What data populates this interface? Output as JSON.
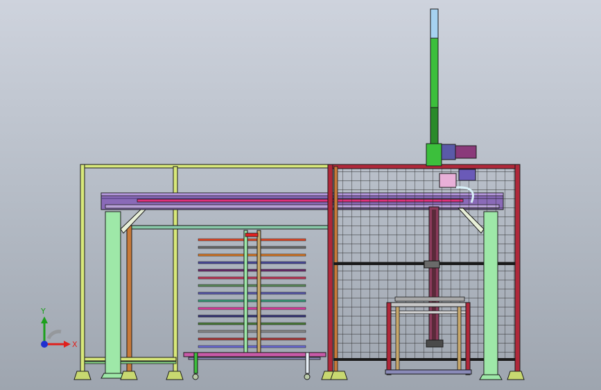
{
  "viewport": {
    "background_top": "#ced3dd",
    "background_bottom": "#9ea5af"
  },
  "triad": {
    "x_label": "X",
    "y_label": "Y",
    "x_color": "#e0201c",
    "y_color": "#1ca01c",
    "z_color": "#2030d0"
  },
  "colors": {
    "frame_yellow": "#d8e87a",
    "frame_green": "#88d888",
    "beam_purple": "#8a6ab8",
    "rail_pink": "#e0307a",
    "fence_red": "#b0283a",
    "mesh": "#2a2a2a",
    "column_green": "#9ee8a8",
    "mast_green": "#3cbf3c",
    "mast_blue": "#a6d2f0",
    "dark_edge": "#1a1a1a"
  },
  "icons": {
    "triad": "coordinate-triad-icon"
  },
  "shelf_colors": [
    "#e04a2a",
    "#6a6a6a",
    "#d87a2a",
    "#4a4a9a",
    "#6a2a6a",
    "#c03a5a",
    "#5a8a5a",
    "#5a5aaa",
    "#3a9a7a",
    "#e03aa0",
    "#3a3a7a",
    "#4a7a3a",
    "#8a8a8a",
    "#aa3a3a",
    "#6a6ad8"
  ]
}
